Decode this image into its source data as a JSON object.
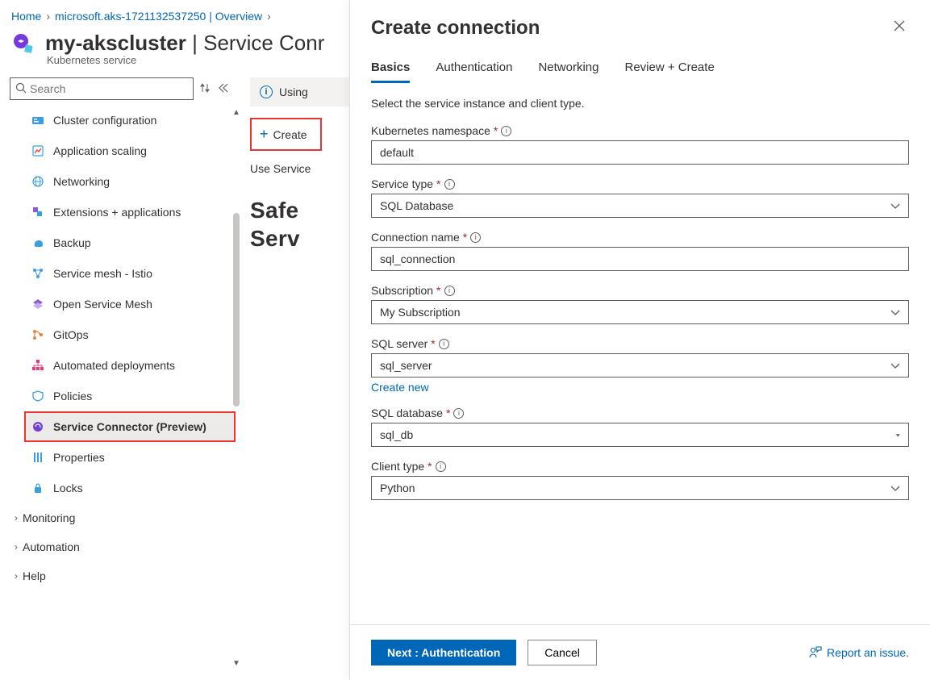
{
  "breadcrumb": {
    "home": "Home",
    "parent": "microsoft.aks-1721132537250 | Overview"
  },
  "header": {
    "title": "my-akscluster",
    "section": "Service Conr",
    "subtitle": "Kubernetes service"
  },
  "search": {
    "placeholder": "Search"
  },
  "nav": {
    "items": [
      {
        "label": "Cluster configuration"
      },
      {
        "label": "Application scaling"
      },
      {
        "label": "Networking"
      },
      {
        "label": "Extensions + applications"
      },
      {
        "label": "Backup"
      },
      {
        "label": "Service mesh - Istio"
      },
      {
        "label": "Open Service Mesh"
      },
      {
        "label": "GitOps"
      },
      {
        "label": "Automated deployments"
      },
      {
        "label": "Policies"
      },
      {
        "label": "Service Connector (Preview)"
      },
      {
        "label": "Properties"
      },
      {
        "label": "Locks"
      }
    ],
    "groups": [
      "Monitoring",
      "Automation",
      "Help"
    ]
  },
  "content": {
    "banner": "Using",
    "create_button": "Create",
    "desc": "Use Service ",
    "heading_line1": "Safe",
    "heading_line2": "Serv"
  },
  "panel": {
    "title": "Create connection",
    "tabs": [
      "Basics",
      "Authentication",
      "Networking",
      "Review + Create"
    ],
    "instruction": "Select the service instance and client type.",
    "fields": {
      "namespace": {
        "label": "Kubernetes namespace",
        "value": "default"
      },
      "service_type": {
        "label": "Service type",
        "value": "SQL Database"
      },
      "connection_name": {
        "label": "Connection name",
        "value": "sql_connection"
      },
      "subscription": {
        "label": "Subscription",
        "value": "My Subscription"
      },
      "sql_server": {
        "label": "SQL server",
        "value": "sql_server",
        "create_new": "Create new"
      },
      "sql_database": {
        "label": "SQL database",
        "value": "sql_db"
      },
      "client_type": {
        "label": "Client type",
        "value": "Python"
      }
    },
    "footer": {
      "next": "Next : Authentication",
      "cancel": "Cancel",
      "report": "Report an issue."
    }
  }
}
